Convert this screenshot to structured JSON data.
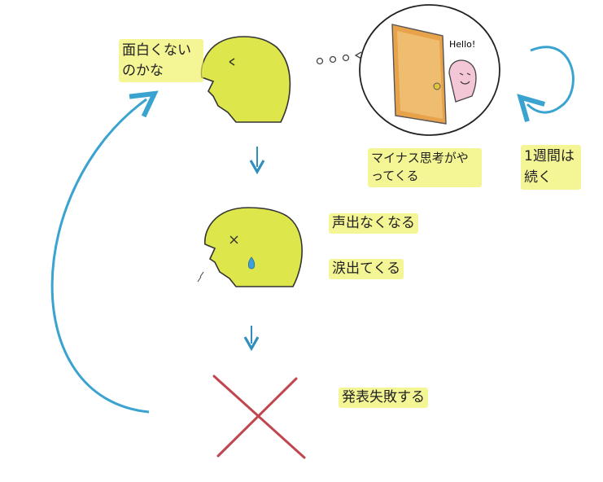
{
  "notes": {
    "top_left": "面白くないのかな",
    "thought_caption": "マイナス思考がやってくる",
    "duration": "1週間は続く",
    "reaction_voice": "声出なくなる",
    "reaction_tears": "涙出てくる",
    "result": "発表失敗する"
  },
  "bubble": {
    "hello": "Hello!"
  },
  "colors": {
    "highlight": "#eef05a",
    "head_fill": "#dde64a",
    "arrow_blue": "#3aa3d0",
    "cross_red": "#c0474f",
    "tear_blue": "#3fa0d8",
    "door_orange": "#e8a24a",
    "ghost_pink": "#f3c7d6"
  },
  "icons": {
    "flow_arrow": "down-arrow-icon",
    "loop_arrow": "cycle-arrow-icon",
    "fail_mark": "cross-icon"
  }
}
